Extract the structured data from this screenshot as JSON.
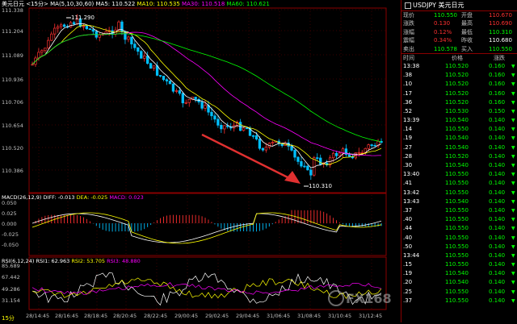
{
  "header": {
    "symbol": "美元日元",
    "period": "<15分>",
    "ma_label": "MA(5,10,30,60)",
    "ma5": "MA5: 110.522",
    "ma10": "MA10: 110.535",
    "ma30": "MA30: 110.518",
    "ma60": "MA60: 110.621",
    "colors": {
      "ma5": "#ffffff",
      "ma10": "#ffff00",
      "ma30": "#ff00ff",
      "ma60": "#00ff00"
    }
  },
  "macd": {
    "label": "MACD(26,12,9)",
    "diff": "DIFF: -0.013",
    "dea": "DEA: -0.025",
    "macd": "MACD: 0.023",
    "ticks": [
      "0.050",
      "0.025",
      "0.000",
      "-0.025",
      "-0.050"
    ]
  },
  "rsi": {
    "label": "RSI(6,12,24)",
    "rsi1": "RSI1: 62.963",
    "rsi2": "RSI2: 53.705",
    "rsi3": "RSI3: 48.880",
    "ticks": [
      "85.689",
      "67.442",
      "49.286",
      "31.154"
    ]
  },
  "price_axis": [
    "111.338",
    "111.204",
    "111.089",
    "110.936",
    "110.706",
    "110.654",
    "110.520",
    "110.386"
  ],
  "time_axis": [
    "28/14:45",
    "28/16:45",
    "28/18:45",
    "28/20:45",
    "28/22:45",
    "29/00:45",
    "29/02:45",
    "29/04:45",
    "31/06:45",
    "31/08:45",
    "31/10:45",
    "31/12:45"
  ],
  "annotations": {
    "high": "111.290",
    "low": "110.310"
  },
  "period_tag": "15分",
  "watermark": "FX168",
  "side": {
    "title": "USDJPY 美元日元",
    "quote": [
      {
        "l": "现价",
        "v": "110.550",
        "l2": "开盘",
        "v2": "110.670",
        "c1": "#00ff00",
        "c2": "#ff3030"
      },
      {
        "l": "涨跌",
        "v": "0.130",
        "l2": "最高",
        "v2": "110.690",
        "c1": "#ff3030",
        "c2": "#ff3030"
      },
      {
        "l": "涨幅",
        "v": "0.12%",
        "l2": "最低",
        "v2": "110.310",
        "c1": "#ff3030",
        "c2": "#00ff00"
      },
      {
        "l": "震幅",
        "v": "0.34%",
        "l2": "昨收",
        "v2": "110.680",
        "c1": "#ff3030",
        "c2": "#ffffff"
      },
      {
        "l": "卖出",
        "v": "110.578",
        "l2": "买入",
        "v2": "110.550",
        "c1": "#00ff00",
        "c2": "#00ff00"
      }
    ],
    "tick_headers": {
      "time": "时间",
      "price": "价格",
      "change": "涨跌"
    },
    "ticks": [
      {
        "t": "13:38",
        "p": "110.520",
        "c": "0.160"
      },
      {
        "t": ".38",
        "p": "110.520",
        "c": "0.160"
      },
      {
        "t": ".10",
        "p": "110.520",
        "c": "0.160"
      },
      {
        "t": ".17",
        "p": "110.520",
        "c": "0.160"
      },
      {
        "t": ".36",
        "p": "110.520",
        "c": "0.160"
      },
      {
        "t": ".52",
        "p": "110.530",
        "c": "0.150"
      },
      {
        "t": "13:39",
        "p": "110.540",
        "c": "0.140"
      },
      {
        "t": ".14",
        "p": "110.550",
        "c": "0.140"
      },
      {
        "t": ".19",
        "p": "110.540",
        "c": "0.140"
      },
      {
        "t": ".27",
        "p": "110.540",
        "c": "0.140"
      },
      {
        "t": ".28",
        "p": "110.520",
        "c": "0.140"
      },
      {
        "t": ".30",
        "p": "110.540",
        "c": "0.140"
      },
      {
        "t": "13:40",
        "p": "110.550",
        "c": "0.140"
      },
      {
        "t": ".41",
        "p": "110.550",
        "c": "0.140"
      },
      {
        "t": "13:42",
        "p": "110.550",
        "c": "0.140"
      },
      {
        "t": "13:43",
        "p": "110.540",
        "c": "0.140"
      },
      {
        "t": ".37",
        "p": "110.550",
        "c": "0.140"
      },
      {
        "t": ".40",
        "p": "110.550",
        "c": "0.140"
      },
      {
        "t": ".44",
        "p": "110.550",
        "c": "0.140"
      },
      {
        "t": ".40",
        "p": "110.550",
        "c": "0.140"
      },
      {
        "t": ".50",
        "p": "110.550",
        "c": "0.140"
      },
      {
        "t": "13:44",
        "p": "110.550",
        "c": "0.140"
      },
      {
        "t": ".15",
        "p": "110.550",
        "c": "0.140"
      },
      {
        "t": ".19",
        "p": "110.540",
        "c": "0.140"
      },
      {
        "t": ".20",
        "p": "110.540",
        "c": "0.140"
      },
      {
        "t": ".25",
        "p": "110.550",
        "c": "0.140"
      },
      {
        "t": ".37",
        "p": "110.550",
        "c": "0.140"
      }
    ]
  }
}
